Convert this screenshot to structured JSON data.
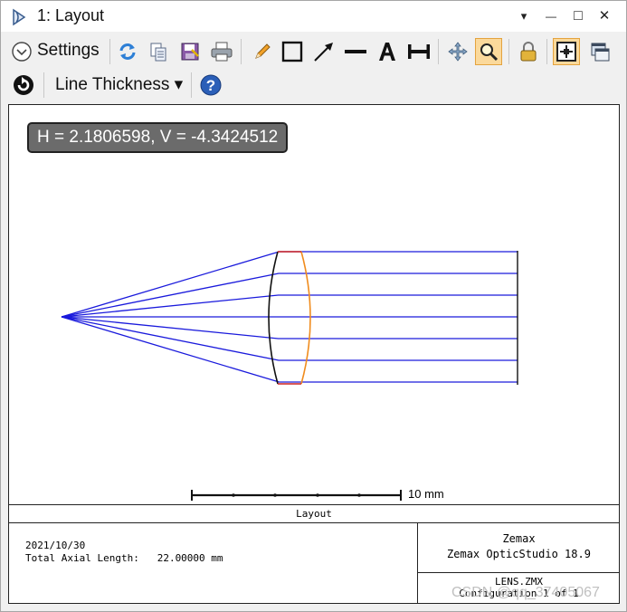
{
  "window": {
    "title": "1: Layout",
    "controls": [
      "▾",
      "—",
      "□",
      "✕"
    ]
  },
  "toolbar1": {
    "settings_label": "Settings",
    "buttons": [
      "refresh-icon",
      "copy-icon",
      "save-icon",
      "print-icon",
      "pencil-icon",
      "rectangle-icon",
      "arrow-icon",
      "line-icon",
      "text-icon",
      "dimension-icon",
      "pan-icon",
      "zoom-icon",
      "lock-icon",
      "fit-icon",
      "window-icon"
    ]
  },
  "toolbar2": {
    "line_thickness_label": "Line Thickness ▾",
    "help_label": "?"
  },
  "plot": {
    "cursor_readout": "H = 2.1806598, V = -4.3424512",
    "scale_label": "10 mm",
    "colors": {
      "rays": "#1a1adc",
      "surface1": "#111111",
      "surface2": "#f08c1e",
      "edge": "#cc2222"
    }
  },
  "footer": {
    "title": "Layout",
    "date": "2021/10/30",
    "total_axial_length": "Total Axial Length:   22.00000 mm",
    "company": "Zemax",
    "product": "Zemax OpticStudio 18.9",
    "file": "LENS.ZMX",
    "configuration": "Configuration 1 of 1"
  },
  "watermark": "CSDN @qq_37405067"
}
